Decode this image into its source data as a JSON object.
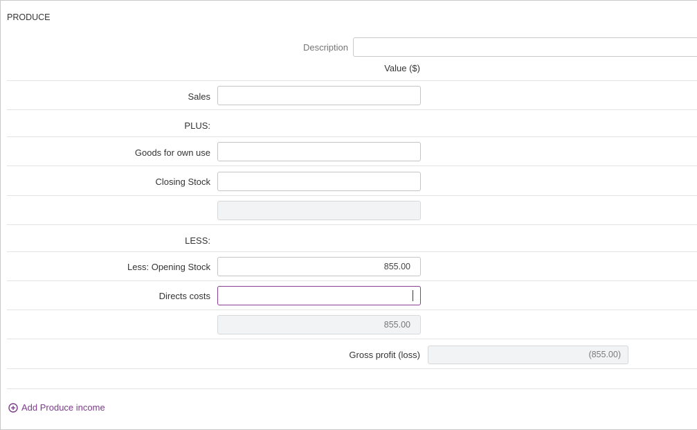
{
  "section": {
    "title": "PRODUCE"
  },
  "description": {
    "label": "Description",
    "value": ""
  },
  "columns": {
    "value_header": "Value ($)"
  },
  "rows": {
    "sales": {
      "label": "Sales",
      "value": ""
    },
    "plus": {
      "label": "PLUS:"
    },
    "goods_own_use": {
      "label": "Goods for own use",
      "value": ""
    },
    "closing_stock": {
      "label": "Closing Stock",
      "value": ""
    },
    "plus_subtotal": {
      "value": ""
    },
    "less": {
      "label": "LESS:"
    },
    "opening_stock": {
      "label": "Less: Opening Stock",
      "value": "855.00"
    },
    "direct_costs": {
      "label": "Directs costs",
      "value": ""
    },
    "less_subtotal": {
      "value": "855.00"
    }
  },
  "gross_profit": {
    "label": "Gross profit (loss)",
    "value": "(855.00)"
  },
  "add_link": {
    "label": "Add Produce income",
    "icon": "add-circle-icon",
    "color": "#7b3a8a"
  },
  "colors": {
    "accent": "#7b3a8a",
    "focus_border": "#8a3d91",
    "readonly_bg": "#f2f3f4"
  }
}
